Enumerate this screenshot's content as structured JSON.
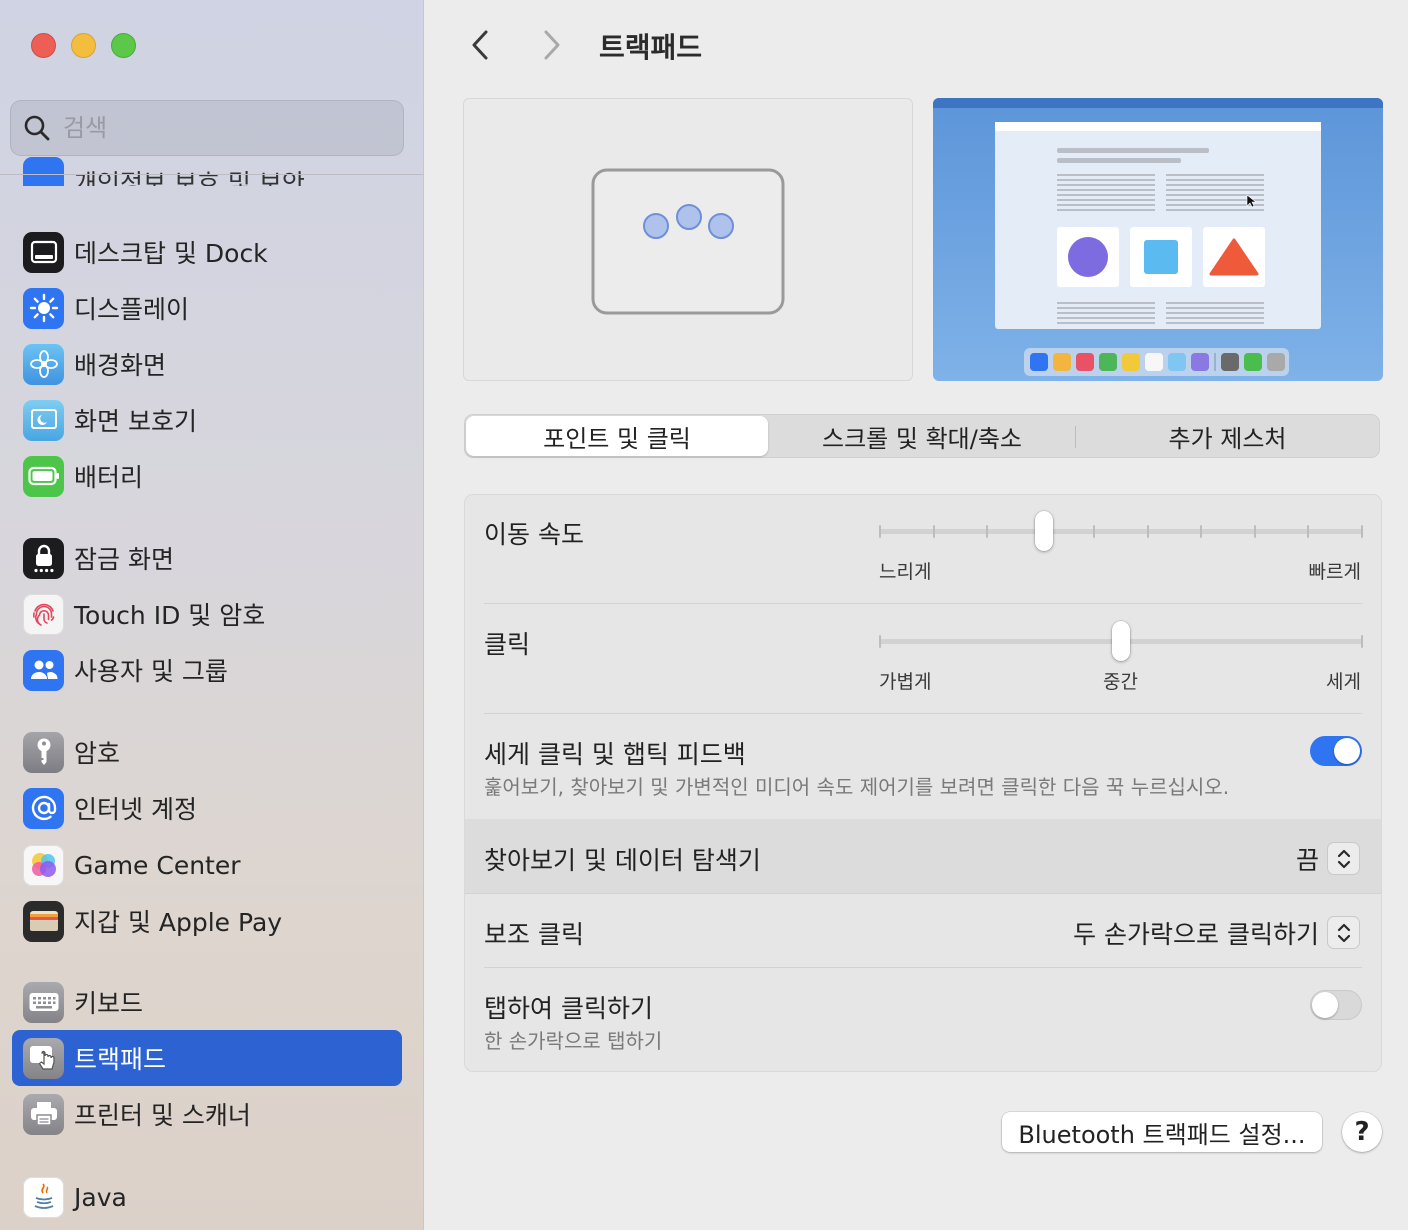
{
  "window": {
    "title": "트랙패드"
  },
  "search": {
    "placeholder": "검색"
  },
  "sidebar": {
    "partial_item": {
      "label": "개인정보 보호 및 보안",
      "icon": "hand-icon"
    },
    "items": [
      {
        "label": "데스크탑 및 Dock",
        "icon": "dock-icon",
        "color": "#1c1c1e"
      },
      {
        "label": "디스플레이",
        "icon": "sun-icon",
        "color": "#2f74f0"
      },
      {
        "label": "배경화면",
        "icon": "flower-icon",
        "color": "#4ea7e8"
      },
      {
        "label": "화면 보호기",
        "icon": "screensaver-icon",
        "color": "#5fb3e6"
      },
      {
        "label": "배터리",
        "icon": "battery-icon",
        "color": "#4cc549"
      },
      {
        "label": "잠금 화면",
        "icon": "lock-icon",
        "color": "#1c1c1e"
      },
      {
        "label": "Touch ID 및 암호",
        "icon": "fingerprint-icon",
        "color": "#f2f2f2"
      },
      {
        "label": "사용자 및 그룹",
        "icon": "users-icon",
        "color": "#2f74f0"
      },
      {
        "label": "암호",
        "icon": "key-icon",
        "color": "#8e8e93"
      },
      {
        "label": "인터넷 계정",
        "icon": "at-icon",
        "color": "#2f74f0"
      },
      {
        "label": "Game Center",
        "icon": "game-center-icon",
        "color": "#f2f2f2"
      },
      {
        "label": "지갑 및 Apple Pay",
        "icon": "wallet-icon",
        "color": "#2b2b2b"
      },
      {
        "label": "키보드",
        "icon": "keyboard-icon",
        "color": "#8e8e93"
      },
      {
        "label": "트랙패드",
        "icon": "trackpad-icon",
        "color": "#8e8e93",
        "active": true
      },
      {
        "label": "프린터 및 스캐너",
        "icon": "printer-icon",
        "color": "#8e8e93"
      },
      {
        "label": "Java",
        "icon": "java-icon",
        "color": "#ffffff"
      }
    ]
  },
  "tabs": [
    {
      "label": "포인트 및 클릭",
      "active": true
    },
    {
      "label": "스크롤 및 확대/축소",
      "active": false
    },
    {
      "label": "추가 제스처",
      "active": false
    }
  ],
  "settings": {
    "tracking_speed": {
      "label": "이동 속도",
      "min_label": "느리게",
      "max_label": "빠르게",
      "value": 0.34,
      "ticks": 10
    },
    "click": {
      "label": "클릭",
      "min_label": "가볍게",
      "mid_label": "중간",
      "max_label": "세게",
      "value": 0.5
    },
    "force_click": {
      "label": "세게 클릭 및 햅틱 피드백",
      "description": "훑어보기, 찾아보기 및 가변적인 미디어 속도 제어기를 보려면 클릭한 다음 꾹 누르십시오.",
      "on": true
    },
    "lookup": {
      "label": "찾아보기 및 데이터 탐색기",
      "value": "끔"
    },
    "secondary_click": {
      "label": "보조 클릭",
      "value": "두 손가락으로 클릭하기"
    },
    "tap_to_click": {
      "label": "탭하여 클릭하기",
      "description": "한 손가락으로 탭하기",
      "on": false
    }
  },
  "buttons": {
    "bluetooth": "Bluetooth 트랙패드 설정...",
    "help": "?"
  },
  "colors": {
    "accent": "#2f74f0",
    "selection": "#2d62d3"
  }
}
